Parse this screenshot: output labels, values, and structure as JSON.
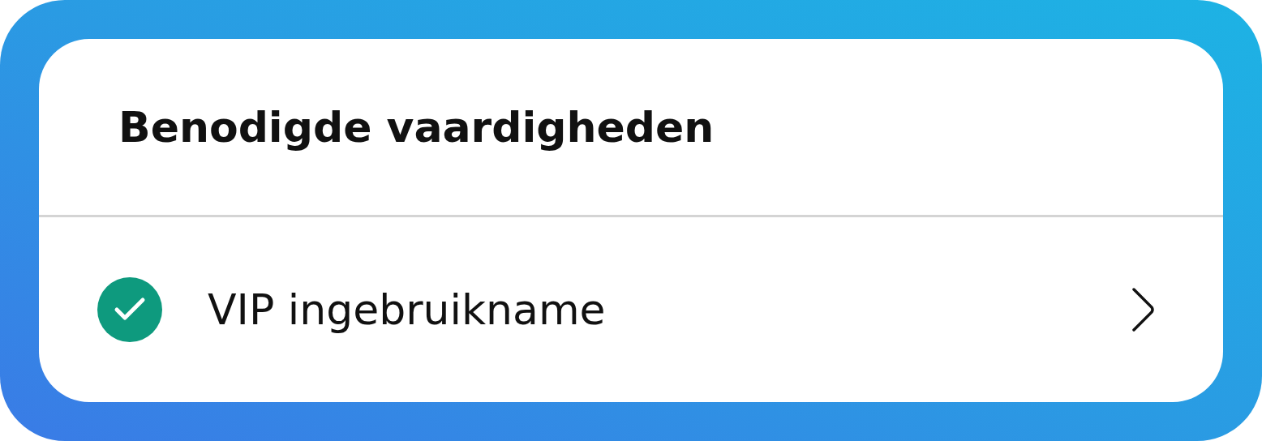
{
  "title": "Benodigde vaardigheden",
  "skills": [
    {
      "label": "VIP ingebruikname",
      "checked": true
    }
  ]
}
